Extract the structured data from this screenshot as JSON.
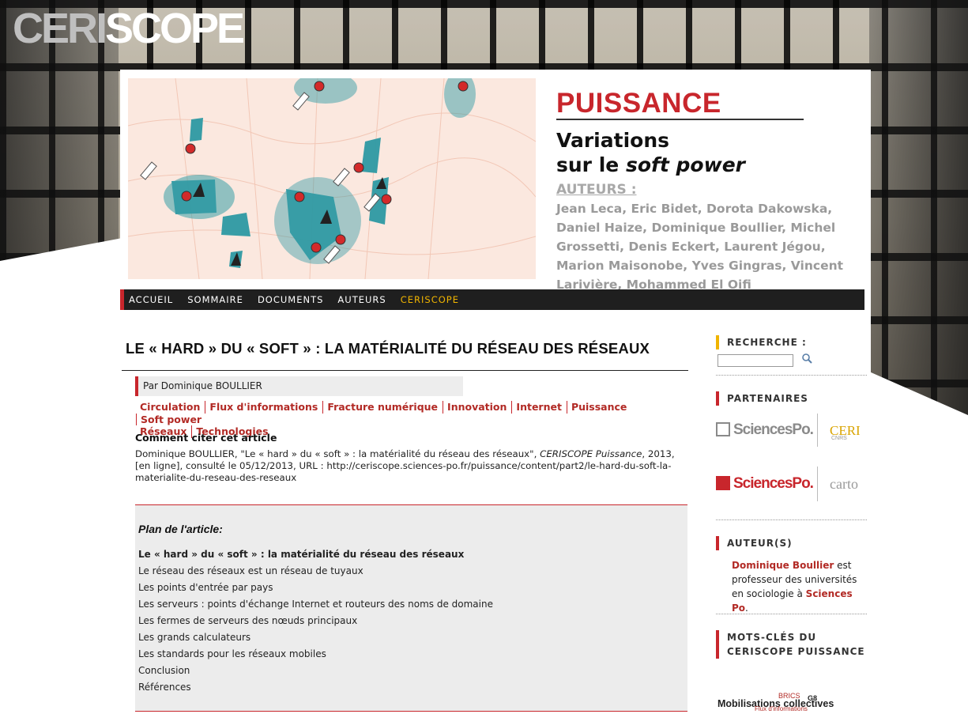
{
  "site": {
    "logo_part1": "CERI",
    "logo_part2": "SCOPE"
  },
  "hero": {
    "section": "PUISSANCE",
    "subtitle_line1": "Variations",
    "subtitle_line2_prefix": "sur le ",
    "subtitle_line2_em": "soft power",
    "authors_label": "AUTEURS :",
    "authors": "Jean Leca, Eric Bidet, Dorota Dakowska, Daniel Haize, Dominique Boullier, Michel Grossetti, Denis Eckert, Laurent Jégou, Marion Maisonobe, Yves Gingras, Vincent Larivière, Mohammed El Oifi"
  },
  "nav": {
    "items": [
      "ACCUEIL",
      "SOMMAIRE",
      "DOCUMENTS",
      "AUTEURS",
      "CERISCOPE"
    ],
    "active_index": 4
  },
  "article": {
    "title": "LE « HARD » DU « SOFT » : LA MATÉRIALITÉ DU RÉSEAU DES RÉSEAUX",
    "byline": "Par Dominique BOULLIER",
    "tags": [
      "Circulation",
      "Flux d'informations",
      "Fracture numérique",
      "Innovation",
      "Internet",
      "Puissance",
      "Soft power",
      "Réseaux",
      "Technologies"
    ],
    "cite_heading": "Comment citer cet article",
    "cite_prefix": "Dominique BOULLIER, \"Le « hard » du « soft » : la matérialité du réseau des réseaux\", ",
    "cite_em": "CERISCOPE Puissance",
    "cite_suffix": ", 2013, [en ligne], consulté le 05/12/2013, URL : http://ceriscope.sciences-po.fr/puissance/content/part2/le-hard-du-soft-la-materialite-du-reseau-des-reseaux"
  },
  "plan": {
    "title": "Plan de l'article:",
    "items": [
      "Le « hard » du « soft » : la matérialité du réseau des réseaux",
      "Le réseau des réseaux est un réseau de tuyaux",
      "Les points d'entrée par pays",
      "Les serveurs : points d'échange Internet et routeurs des noms de domaine",
      "Les fermes de serveurs des nœuds principaux",
      "Les grands calculateurs",
      "Les standards pour les réseaux mobiles",
      "Conclusion",
      "Références"
    ]
  },
  "sidebar": {
    "search_heading": "RECHERCHE :",
    "partners_heading": "PARTENAIRES",
    "partner1": "SciencesPo.",
    "partner1b": "CERI",
    "partner1c": "CNRS",
    "partner2": "SciencesPo.",
    "partner2b": "carto",
    "authors_heading": "AUTEUR(S)",
    "author_name": "Dominique Boullier",
    "author_text1": " est professeur des universités en sociologie à ",
    "author_inst": "Sciences Po",
    "author_text2": ".",
    "keywords_heading_line1": "MOTS-CLÉS DU",
    "keywords_heading_line2": "CERISCOPE PUISSANCE",
    "keywords": [
      "Mobilisations collectives",
      "BRICS",
      "G8",
      "Flux d'informations"
    ]
  },
  "colors": {
    "accent_red": "#c8262c",
    "accent_yellow": "#f0b400",
    "nav_bg": "#1f1f1f",
    "map_teal": "#2e9aa4"
  }
}
